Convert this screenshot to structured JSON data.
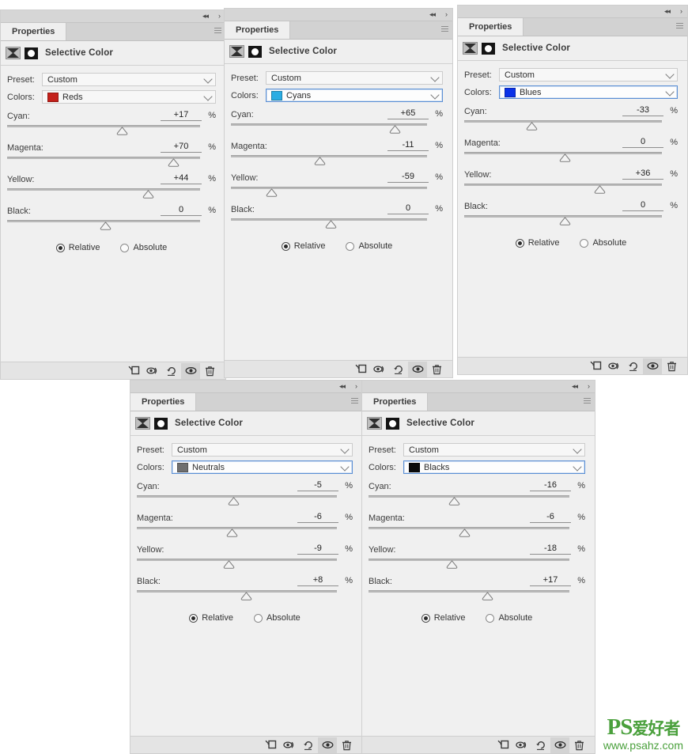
{
  "window": {
    "title": "Selective Color",
    "tab_label": "Properties",
    "collapse_icon": "collapse-double-arrow-icon",
    "expand_icon": "expand-arrow-icon",
    "menu_icon": "panel-menu-icon"
  },
  "labels": {
    "preset": "Preset:",
    "colors": "Colors:",
    "cyan": "Cyan:",
    "magenta": "Magenta:",
    "yellow": "Yellow:",
    "black": "Black:",
    "percent": "%",
    "relative": "Relative",
    "absolute": "Absolute"
  },
  "footer_buttons": [
    {
      "name": "clip-to-layer-icon",
      "title": "Clip to layer"
    },
    {
      "name": "view-previous-state-icon",
      "title": "View previous state"
    },
    {
      "name": "reset-icon",
      "title": "Reset to default"
    },
    {
      "name": "toggle-visibility-icon",
      "title": "Toggle layer visibility"
    },
    {
      "name": "delete-icon",
      "title": "Delete this adjustment layer"
    }
  ],
  "panels": [
    {
      "id": "reds",
      "preset": "Custom",
      "color_name": "Reds",
      "swatch": "#c4201a",
      "focused": false,
      "mode": "Relative",
      "sliders": [
        {
          "label": "Cyan:",
          "value": "+17",
          "pos": 58.5
        },
        {
          "label": "Magenta:",
          "value": "+70",
          "pos": 85.0
        },
        {
          "label": "Yellow:",
          "value": "+44",
          "pos": 72.0
        },
        {
          "label": "Black:",
          "value": "0",
          "pos": 50.0
        }
      ]
    },
    {
      "id": "cyans",
      "preset": "Custom",
      "color_name": "Cyans",
      "swatch": "#2aade3",
      "focused": true,
      "mode": "Relative",
      "sliders": [
        {
          "label": "Cyan:",
          "value": "+65",
          "pos": 82.5
        },
        {
          "label": "Magenta:",
          "value": "-11",
          "pos": 44.5
        },
        {
          "label": "Yellow:",
          "value": "-59",
          "pos": 20.5
        },
        {
          "label": "Black:",
          "value": "0",
          "pos": 50.0
        }
      ]
    },
    {
      "id": "blues",
      "preset": "Custom",
      "color_name": "Blues",
      "swatch": "#0b32e8",
      "focused": true,
      "mode": "Relative",
      "sliders": [
        {
          "label": "Cyan:",
          "value": "-33",
          "pos": 33.5
        },
        {
          "label": "Magenta:",
          "value": "0",
          "pos": 50.0
        },
        {
          "label": "Yellow:",
          "value": "+36",
          "pos": 67.5
        },
        {
          "label": "Black:",
          "value": "0",
          "pos": 50.0
        }
      ]
    },
    {
      "id": "neutrals",
      "preset": "Custom",
      "color_name": "Neutrals",
      "swatch": "#6f6f6f",
      "focused": true,
      "mode": "Relative",
      "sliders": [
        {
          "label": "Cyan:",
          "value": "-5",
          "pos": 47.5
        },
        {
          "label": "Magenta:",
          "value": "-6",
          "pos": 47.0
        },
        {
          "label": "Yellow:",
          "value": "-9",
          "pos": 45.5
        },
        {
          "label": "Black:",
          "value": "+8",
          "pos": 54.0
        }
      ]
    },
    {
      "id": "blacks",
      "preset": "Custom",
      "color_name": "Blacks",
      "swatch": "#0b0b0b",
      "focused": true,
      "mode": "Relative",
      "sliders": [
        {
          "label": "Cyan:",
          "value": "-16",
          "pos": 42.0
        },
        {
          "label": "Magenta:",
          "value": "-6",
          "pos": 47.0
        },
        {
          "label": "Yellow:",
          "value": "-18",
          "pos": 41.0
        },
        {
          "label": "Black:",
          "value": "+17",
          "pos": 58.5
        }
      ]
    }
  ],
  "watermark": {
    "ps": "PS",
    "cn": "爱好者",
    "url": "www.psahz.com",
    "color": "#4aa03c"
  }
}
